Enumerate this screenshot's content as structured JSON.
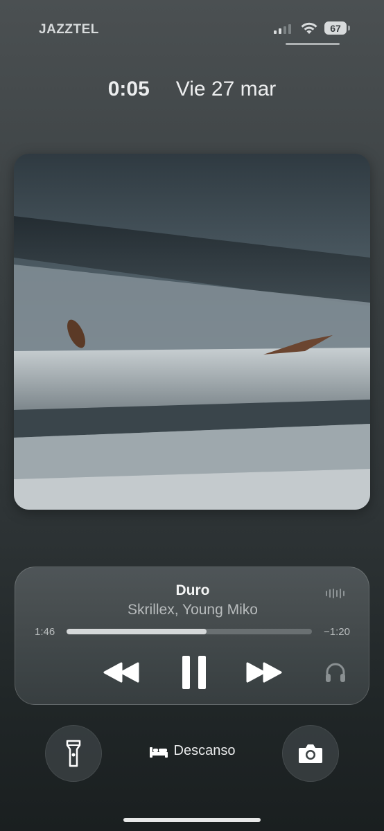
{
  "status_bar": {
    "carrier": "JAZZTEL",
    "battery_level": "67",
    "signal_bars_filled": 2,
    "signal_bars_total": 4
  },
  "lock_screen": {
    "time": "0:05",
    "date": "Vie 27 mar"
  },
  "now_playing": {
    "title": "Duro",
    "artist": "Skrillex, Young Miko",
    "elapsed": "1:46",
    "remaining": "−1:20",
    "progress_fraction": 0.57,
    "controls": {
      "rewind_icon": "backward-icon",
      "pause_icon": "pause-icon",
      "forward_icon": "forward-icon",
      "output_icon": "headphones-icon"
    }
  },
  "bottom": {
    "flashlight_icon": "flashlight-icon",
    "focus_label": "Descanso",
    "focus_icon": "bed-icon",
    "camera_icon": "camera-icon"
  },
  "colors": {
    "background_top": "#4b5052",
    "background_bottom": "#1a1f20",
    "progress_fill": "#d5d8d9",
    "progress_track": "#6a7072"
  }
}
